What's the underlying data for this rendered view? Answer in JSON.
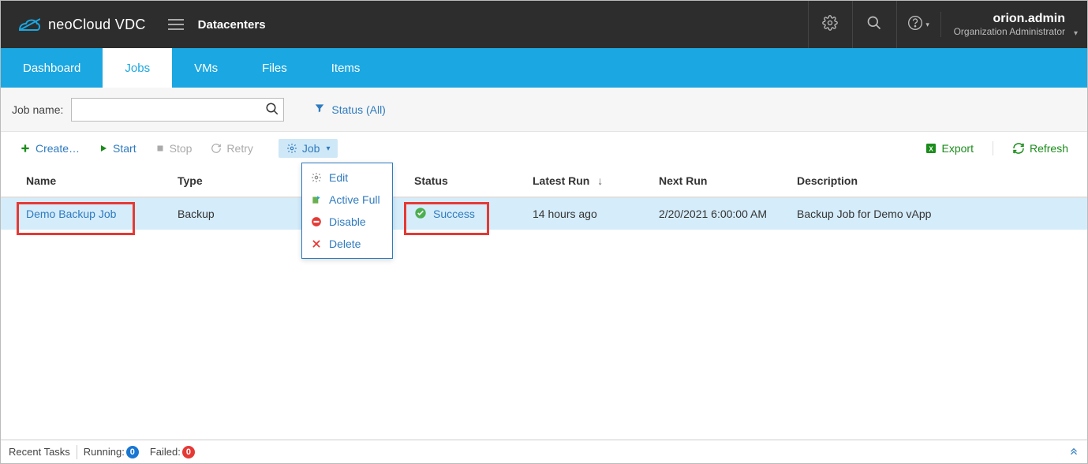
{
  "header": {
    "product": "neoCloud VDC",
    "nav_label": "Datacenters",
    "user_name": "orion.admin",
    "user_role": "Organization Administrator"
  },
  "tabs": [
    {
      "label": "Dashboard",
      "active": false
    },
    {
      "label": "Jobs",
      "active": true
    },
    {
      "label": "VMs",
      "active": false
    },
    {
      "label": "Files",
      "active": false
    },
    {
      "label": "Items",
      "active": false
    }
  ],
  "filter": {
    "label": "Job name:",
    "status_label": "Status (All)"
  },
  "toolbar": {
    "create": "Create…",
    "start": "Start",
    "stop": "Stop",
    "retry": "Retry",
    "job": "Job",
    "export": "Export",
    "refresh": "Refresh"
  },
  "dropdown": {
    "edit": "Edit",
    "active_full": "Active Full",
    "disable": "Disable",
    "delete": "Delete"
  },
  "columns": {
    "name": "Name",
    "type": "Type",
    "status": "Status",
    "latest": "Latest Run",
    "next": "Next Run",
    "desc": "Description"
  },
  "rows": [
    {
      "name": "Demo Backup Job",
      "type": "Backup",
      "status": "Success",
      "latest": "14 hours ago",
      "next": "2/20/2021 6:00:00 AM",
      "desc": "Backup Job for Demo vApp"
    }
  ],
  "footer": {
    "recent": "Recent Tasks",
    "running_label": "Running:",
    "running_count": "0",
    "failed_label": "Failed:",
    "failed_count": "0"
  }
}
